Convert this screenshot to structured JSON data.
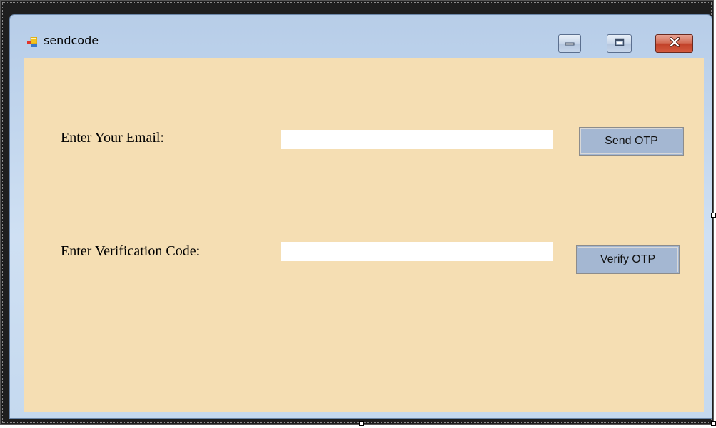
{
  "window": {
    "title": "sendcode",
    "icon": "winforms-app-icon",
    "minimize_icon": "minimize-icon",
    "maximize_icon": "maximize-icon",
    "close_icon": "close-icon"
  },
  "form": {
    "background_color": "#F5DEB3",
    "email": {
      "label": "Enter Your Email:",
      "value": "",
      "button_label": "Send OTP"
    },
    "code": {
      "label": "Enter Verification Code:",
      "value": "",
      "button_label": "Verify OTP"
    },
    "button_color": "#A4B7D2"
  }
}
